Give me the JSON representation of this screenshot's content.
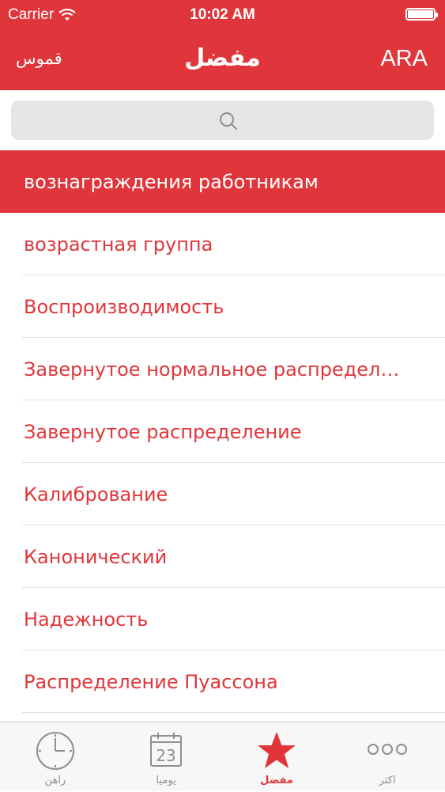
{
  "status_bar": {
    "carrier": "Carrier",
    "time": "10:02 AM"
  },
  "nav": {
    "left_label": "قموس",
    "title": "مفضل",
    "right_label": "ARA"
  },
  "search": {
    "placeholder": ""
  },
  "items": [
    {
      "label": "вознаграждения работникам",
      "selected": true
    },
    {
      "label": "возрастная группа"
    },
    {
      "label": "Воспроизводимость"
    },
    {
      "label": "Завернутое нормальное распредел…"
    },
    {
      "label": "Завернутое распределение"
    },
    {
      "label": "Калибрование"
    },
    {
      "label": "Канонический"
    },
    {
      "label": "Надежность"
    },
    {
      "label": "Распределение Пуассона"
    }
  ],
  "tabs": [
    {
      "label": "راهن",
      "icon": "clock-icon"
    },
    {
      "label": "يوميا",
      "icon": "calendar-icon",
      "calendar_day": "23"
    },
    {
      "label": "مفضل",
      "icon": "star-icon",
      "active": true
    },
    {
      "label": "اكثر",
      "icon": "more-icon"
    }
  ],
  "colors": {
    "accent": "#e0363b",
    "tab_inactive": "#8e8e93"
  }
}
